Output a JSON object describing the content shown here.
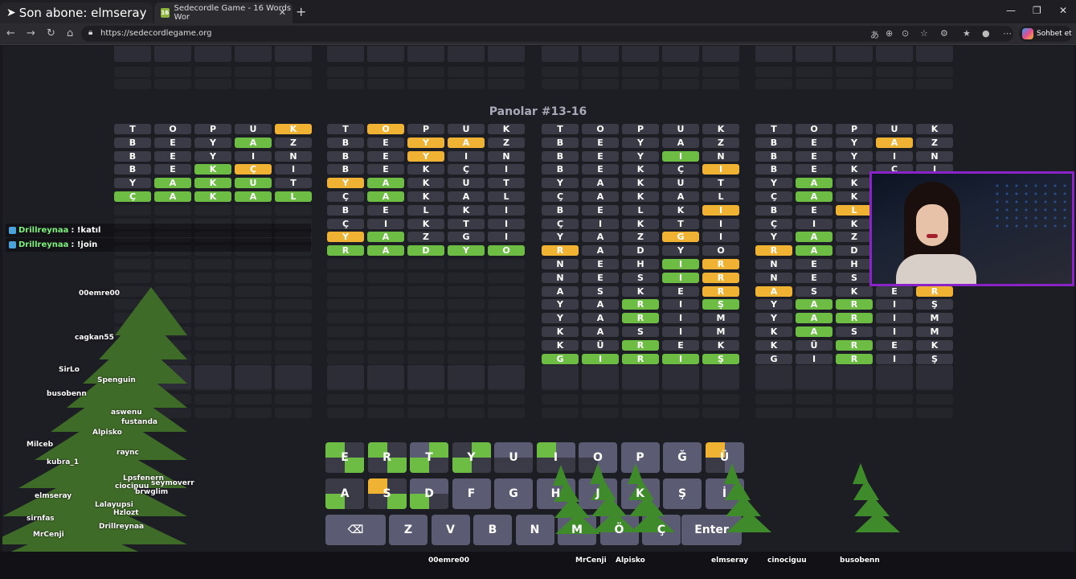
{
  "browser": {
    "tab1_title": "Son abone: elmseray",
    "tab2_title": "Sedecordle Game - 16 Words Wor",
    "url": "https://sedecordlegame.org",
    "copilot_label": "Sohbet et"
  },
  "game": {
    "title": "Panolar #13-16",
    "boards": [
      {
        "rows": [
          [
            "T",
            "O",
            "P",
            "U",
            "K"
          ],
          [
            "B",
            "E",
            "Y",
            "A",
            "Z"
          ],
          [
            "B",
            "E",
            "Y",
            "I",
            "N"
          ],
          [
            "B",
            "E",
            "K",
            "Ç",
            "I"
          ],
          [
            "Y",
            "A",
            "K",
            "U",
            "T"
          ],
          [
            "Ç",
            "A",
            "K",
            "A",
            "L"
          ]
        ],
        "states": [
          [
            "n",
            "n",
            "n",
            "n",
            "y"
          ],
          [
            "n",
            "n",
            "n",
            "g",
            "n"
          ],
          [
            "n",
            "n",
            "n",
            "n",
            "n"
          ],
          [
            "n",
            "n",
            "g",
            "y",
            "n"
          ],
          [
            "n",
            "g",
            "g",
            "g",
            "n"
          ],
          [
            "g",
            "g",
            "g",
            "g",
            "g"
          ]
        ]
      },
      {
        "rows": [
          [
            "T",
            "O",
            "P",
            "U",
            "K"
          ],
          [
            "B",
            "E",
            "Y",
            "A",
            "Z"
          ],
          [
            "B",
            "E",
            "Y",
            "I",
            "N"
          ],
          [
            "B",
            "E",
            "K",
            "Ç",
            "I"
          ],
          [
            "Y",
            "A",
            "K",
            "U",
            "T"
          ],
          [
            "Ç",
            "A",
            "K",
            "A",
            "L"
          ],
          [
            "B",
            "E",
            "L",
            "K",
            "I"
          ],
          [
            "Ç",
            "I",
            "K",
            "T",
            "I"
          ],
          [
            "Y",
            "A",
            "Z",
            "G",
            "I"
          ],
          [
            "R",
            "A",
            "D",
            "Y",
            "O"
          ]
        ],
        "states": [
          [
            "n",
            "y",
            "n",
            "n",
            "n"
          ],
          [
            "n",
            "n",
            "y",
            "y",
            "n"
          ],
          [
            "n",
            "n",
            "y",
            "n",
            "n"
          ],
          [
            "n",
            "n",
            "n",
            "n",
            "n"
          ],
          [
            "y",
            "g",
            "n",
            "n",
            "n"
          ],
          [
            "n",
            "g",
            "n",
            "n",
            "n"
          ],
          [
            "n",
            "n",
            "n",
            "n",
            "n"
          ],
          [
            "n",
            "n",
            "n",
            "n",
            "n"
          ],
          [
            "y",
            "g",
            "n",
            "n",
            "n"
          ],
          [
            "g",
            "g",
            "g",
            "g",
            "g"
          ]
        ]
      },
      {
        "rows": [
          [
            "T",
            "O",
            "P",
            "U",
            "K"
          ],
          [
            "B",
            "E",
            "Y",
            "A",
            "Z"
          ],
          [
            "B",
            "E",
            "Y",
            "I",
            "N"
          ],
          [
            "B",
            "E",
            "K",
            "Ç",
            "I"
          ],
          [
            "Y",
            "A",
            "K",
            "U",
            "T"
          ],
          [
            "Ç",
            "A",
            "K",
            "A",
            "L"
          ],
          [
            "B",
            "E",
            "L",
            "K",
            "I"
          ],
          [
            "Ç",
            "I",
            "K",
            "T",
            "I"
          ],
          [
            "Y",
            "A",
            "Z",
            "G",
            "I"
          ],
          [
            "R",
            "A",
            "D",
            "Y",
            "O"
          ],
          [
            "N",
            "E",
            "H",
            "I",
            "R"
          ],
          [
            "N",
            "E",
            "S",
            "I",
            "R"
          ],
          [
            "A",
            "S",
            "K",
            "E",
            "R"
          ],
          [
            "Y",
            "A",
            "R",
            "I",
            "Ş"
          ],
          [
            "Y",
            "A",
            "R",
            "I",
            "M"
          ],
          [
            "K",
            "A",
            "S",
            "I",
            "M"
          ],
          [
            "K",
            "Ü",
            "R",
            "E",
            "K"
          ],
          [
            "G",
            "I",
            "R",
            "I",
            "Ş"
          ]
        ],
        "states": [
          [
            "n",
            "n",
            "n",
            "n",
            "n"
          ],
          [
            "n",
            "n",
            "n",
            "n",
            "n"
          ],
          [
            "n",
            "n",
            "n",
            "g",
            "n"
          ],
          [
            "n",
            "n",
            "n",
            "n",
            "y"
          ],
          [
            "n",
            "n",
            "n",
            "n",
            "n"
          ],
          [
            "n",
            "n",
            "n",
            "n",
            "n"
          ],
          [
            "n",
            "n",
            "n",
            "n",
            "y"
          ],
          [
            "n",
            "n",
            "n",
            "n",
            "n"
          ],
          [
            "n",
            "n",
            "n",
            "y",
            "n"
          ],
          [
            "y",
            "n",
            "n",
            "n",
            "n"
          ],
          [
            "n",
            "n",
            "n",
            "g",
            "y"
          ],
          [
            "n",
            "n",
            "n",
            "g",
            "y"
          ],
          [
            "n",
            "n",
            "n",
            "n",
            "y"
          ],
          [
            "n",
            "n",
            "g",
            "n",
            "g"
          ],
          [
            "n",
            "n",
            "g",
            "n",
            "n"
          ],
          [
            "n",
            "n",
            "n",
            "n",
            "n"
          ],
          [
            "n",
            "n",
            "g",
            "n",
            "n"
          ],
          [
            "g",
            "g",
            "g",
            "g",
            "g"
          ]
        ]
      },
      {
        "rows": [
          [
            "T",
            "O",
            "P",
            "U",
            "K"
          ],
          [
            "B",
            "E",
            "Y",
            "A",
            "Z"
          ],
          [
            "B",
            "E",
            "Y",
            "I",
            "N"
          ],
          [
            "B",
            "E",
            "K",
            "Ç",
            "I"
          ],
          [
            "Y",
            "A",
            "K",
            "",
            ""
          ],
          [
            "Ç",
            "A",
            "K",
            "",
            ""
          ],
          [
            "B",
            "E",
            "L",
            "",
            ""
          ],
          [
            "Ç",
            "I",
            "K",
            "",
            ""
          ],
          [
            "Y",
            "A",
            "Z",
            "",
            ""
          ],
          [
            "R",
            "A",
            "D",
            "",
            ""
          ],
          [
            "N",
            "E",
            "H",
            "",
            ""
          ],
          [
            "N",
            "E",
            "S",
            "",
            ""
          ],
          [
            "A",
            "S",
            "K",
            "E",
            "R"
          ],
          [
            "Y",
            "A",
            "R",
            "I",
            "Ş"
          ],
          [
            "Y",
            "A",
            "R",
            "I",
            "M"
          ],
          [
            "K",
            "A",
            "S",
            "I",
            "M"
          ],
          [
            "K",
            "Ü",
            "R",
            "E",
            "K"
          ],
          [
            "G",
            "I",
            "R",
            "I",
            "Ş"
          ]
        ],
        "states": [
          [
            "n",
            "n",
            "n",
            "n",
            "n"
          ],
          [
            "n",
            "n",
            "n",
            "y",
            "n"
          ],
          [
            "n",
            "n",
            "n",
            "n",
            "n"
          ],
          [
            "n",
            "n",
            "n",
            "n",
            "n"
          ],
          [
            "n",
            "g",
            "n",
            "n",
            "n"
          ],
          [
            "n",
            "g",
            "n",
            "n",
            "n"
          ],
          [
            "n",
            "n",
            "y",
            "n",
            "n"
          ],
          [
            "n",
            "n",
            "n",
            "n",
            "n"
          ],
          [
            "n",
            "g",
            "n",
            "n",
            "n"
          ],
          [
            "y",
            "g",
            "n",
            "n",
            "n"
          ],
          [
            "n",
            "n",
            "n",
            "n",
            "n"
          ],
          [
            "n",
            "n",
            "n",
            "n",
            "n"
          ],
          [
            "y",
            "n",
            "n",
            "n",
            "y"
          ],
          [
            "n",
            "g",
            "g",
            "n",
            "n"
          ],
          [
            "n",
            "g",
            "g",
            "n",
            "n"
          ],
          [
            "n",
            "g",
            "n",
            "n",
            "n"
          ],
          [
            "n",
            "n",
            "g",
            "n",
            "n"
          ],
          [
            "n",
            "n",
            "g",
            "n",
            "n"
          ]
        ]
      }
    ],
    "keyboard": {
      "row1": [
        "E",
        "R",
        "T",
        "Y",
        "U",
        "I",
        "O",
        "P",
        "Ğ",
        "Ü"
      ],
      "row2": [
        "A",
        "S",
        "D",
        "F",
        "G",
        "H",
        "J",
        "K",
        "Ş",
        "İ"
      ],
      "row3": [
        "Z",
        "V",
        "B",
        "N",
        "M",
        "Ö",
        "Ç"
      ],
      "enter_label": "Enter",
      "backspace_icon": "backspace-icon"
    }
  },
  "chat": [
    {
      "user": "Drillreynaa",
      "message": "!katıl"
    },
    {
      "user": "Drillreynaa",
      "message": "!join"
    }
  ],
  "overlay": {
    "tree_names": [
      "00emre00",
      "cagkan55",
      "SirLo",
      "Spenguin",
      "busobenn",
      "aswenu",
      "Alpisko",
      "fustanda",
      "Milceb",
      "kubra_1",
      "raync",
      "Lpsfenern",
      "sirnfas",
      "ciocipuu",
      "elmseray",
      "Lalayupsi",
      "Hzlozt",
      "brwglim",
      "Drillreynaa",
      "seymoverr",
      "MrCenji"
    ],
    "bottom_names": [
      "00emre00",
      "MrCenji",
      "Alpisko",
      "elmseray",
      "cinociguu",
      "busobenn"
    ]
  }
}
